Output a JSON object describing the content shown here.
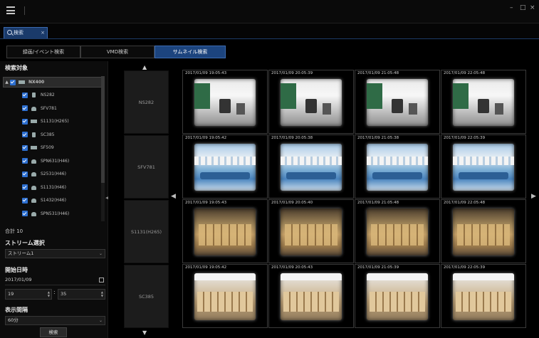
{
  "window": {
    "controls": [
      "–",
      "□",
      "×"
    ]
  },
  "tab": {
    "label": "検索",
    "close": "×"
  },
  "modes": [
    "録画/イベント検索",
    "VMD検索",
    "サムネイル検索"
  ],
  "search_target": {
    "title": "検索対象",
    "root": "NX400",
    "devices": [
      {
        "name": "NS282",
        "icon": "camera"
      },
      {
        "name": "SFV781",
        "icon": "dome"
      },
      {
        "name": "S1131(H265)",
        "icon": "box"
      },
      {
        "name": "SC385",
        "icon": "camera"
      },
      {
        "name": "SF509",
        "icon": "box"
      },
      {
        "name": "SPN631(H46)",
        "icon": "dome"
      },
      {
        "name": "S2531(H46)",
        "icon": "dome"
      },
      {
        "name": "S1131(H46)",
        "icon": "dome"
      },
      {
        "name": "S1432(H46)",
        "icon": "dome"
      },
      {
        "name": "SPN531(H46)",
        "icon": "dome"
      }
    ],
    "total": "合計 10"
  },
  "stream": {
    "title": "ストリーム選択",
    "value": "ストリーム1"
  },
  "start_date": {
    "title": "開始日時",
    "date": "2017/01/09",
    "hour": "19",
    "minute": "35"
  },
  "interval": {
    "title": "表示間隔",
    "value": "60分"
  },
  "search_button": "検索",
  "arrows": {
    "up": "▲",
    "down": "▼",
    "left": "◀",
    "right": "▶",
    "collapse": "◀",
    "expander": "▲"
  },
  "grid": {
    "rows": [
      {
        "camera": "NS282",
        "scene": "office",
        "timestamps": [
          "2017/01/09 19:05:43",
          "2017/01/09 20:05:39",
          "2017/01/09 21:05:48",
          "2017/01/09 22:05:48"
        ]
      },
      {
        "camera": "SFV781",
        "scene": "warehouse",
        "timestamps": [
          "2017/01/09 19:05:42",
          "2017/01/09 20:05:38",
          "2017/01/09 21:05:38",
          "2017/01/09 22:05:39"
        ]
      },
      {
        "camera": "S1131(H265)",
        "scene": "boxes",
        "timestamps": [
          "2017/01/09 19:05:43",
          "2017/01/09 20:05:40",
          "2017/01/09 21:05:48",
          "2017/01/09 22:05:48"
        ]
      },
      {
        "camera": "SC385",
        "scene": "storeroom",
        "timestamps": [
          "2017/01/09 19:05:42",
          "2017/01/09 20:05:43",
          "2017/01/09 21:05:39",
          "2017/01/09 22:05:39"
        ]
      }
    ]
  },
  "colors": {
    "accent": "#1c447e",
    "checkbox": "#2d6fd0",
    "background": "#000000"
  }
}
